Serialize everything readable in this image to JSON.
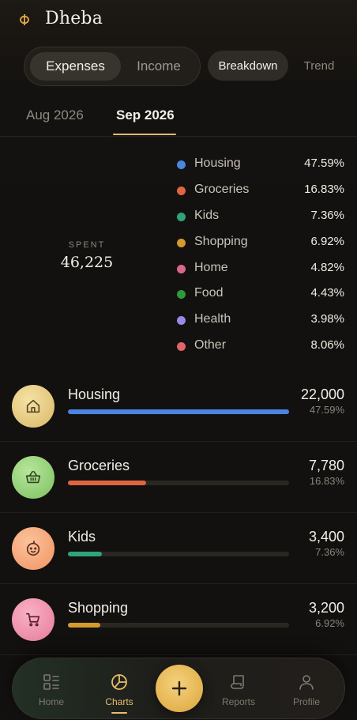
{
  "app": {
    "title": "Dheba"
  },
  "type_toggle": {
    "expenses": "Expenses",
    "income": "Income"
  },
  "view_toggle": {
    "breakdown": "Breakdown",
    "trend": "Trend"
  },
  "months": {
    "previous": "Aug 2026",
    "current": "Sep 2026"
  },
  "summary": {
    "label": "SPENT",
    "value": "46,225"
  },
  "legend": [
    {
      "label": "Housing",
      "percent": "47.59%",
      "color": "#4a86e0"
    },
    {
      "label": "Groceries",
      "percent": "16.83%",
      "color": "#e0653f"
    },
    {
      "label": "Kids",
      "percent": "7.36%",
      "color": "#2fa37a"
    },
    {
      "label": "Shopping",
      "percent": "6.92%",
      "color": "#d49a2b"
    },
    {
      "label": "Home",
      "percent": "4.82%",
      "color": "#d9688e"
    },
    {
      "label": "Food",
      "percent": "4.43%",
      "color": "#2e9a3a"
    },
    {
      "label": "Health",
      "percent": "3.98%",
      "color": "#9b87e6"
    },
    {
      "label": "Other",
      "percent": "8.06%",
      "color": "#e0656a"
    }
  ],
  "categories": [
    {
      "name": "Housing",
      "amount": "22,000",
      "percent": "47.59%",
      "fraction": 1.0,
      "bar_color": "#4a86e0",
      "icon": "house-icon"
    },
    {
      "name": "Groceries",
      "amount": "7,780",
      "percent": "16.83%",
      "fraction": 0.354,
      "bar_color": "#e0653f",
      "icon": "basket-icon"
    },
    {
      "name": "Kids",
      "amount": "3,400",
      "percent": "7.36%",
      "fraction": 0.155,
      "bar_color": "#2fa37a",
      "icon": "baby-face-icon"
    },
    {
      "name": "Shopping",
      "amount": "3,200",
      "percent": "6.92%",
      "fraction": 0.145,
      "bar_color": "#d49a2b",
      "icon": "cart-icon"
    }
  ],
  "nav": {
    "home": "Home",
    "charts": "Charts",
    "reports": "Reports",
    "profile": "Profile"
  }
}
